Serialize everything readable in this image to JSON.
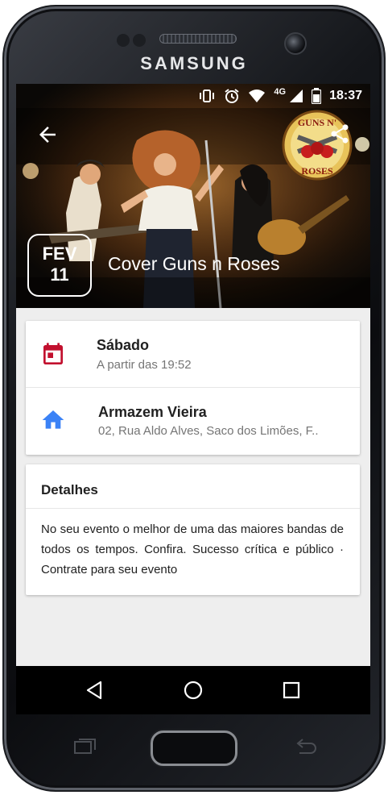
{
  "device": {
    "brand": "SAMSUNG"
  },
  "status_bar": {
    "network": "4G",
    "time": "18:37"
  },
  "event": {
    "date_month": "FEV",
    "date_day": "11",
    "title": "Cover Guns n Roses",
    "logo_text_top": "GUNS N'",
    "logo_text_bottom": "ROSES"
  },
  "info": {
    "day_title": "Sábado",
    "day_subtitle": "A partir das 19:52",
    "venue_title": "Armazem Vieira",
    "venue_subtitle": "02, Rua Aldo Alves, Saco dos Limões, F.."
  },
  "details": {
    "title": "Detalhes",
    "text": "No seu evento o melhor de uma das maiores bandas de todos os tempos. Confira. Sucesso crítica e público · Contrate para seu evento"
  },
  "icons": {
    "back": "arrow-left-icon",
    "share": "share-icon",
    "calendar": "calendar-icon",
    "home": "home-icon",
    "nav_back": "triangle-back-icon",
    "nav_home": "circle-home-icon",
    "nav_recents": "square-recents-icon"
  },
  "colors": {
    "calendar_icon": "#c2102e",
    "home_icon": "#3b82f6",
    "screen_background": "#eeeeee",
    "navbar": "#000000"
  }
}
